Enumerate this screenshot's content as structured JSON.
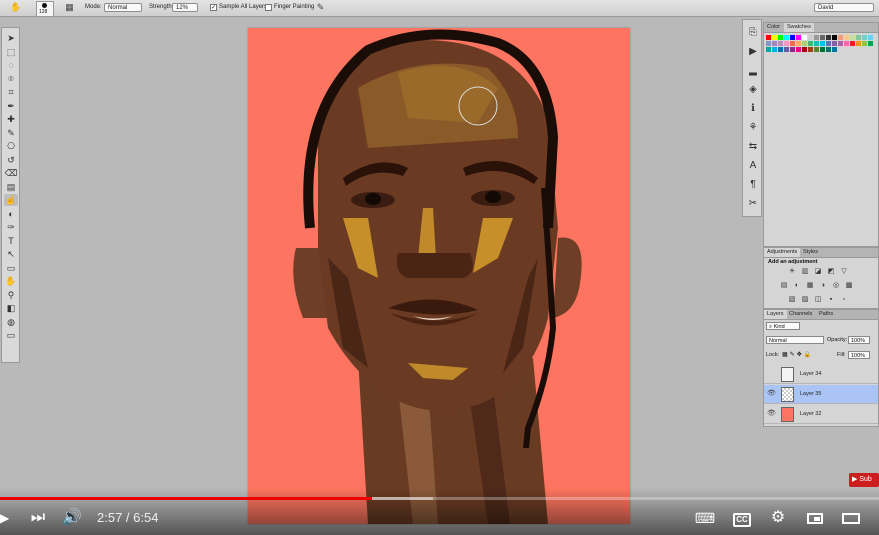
{
  "options_bar": {
    "brush_size": "128",
    "mode_label": "Mode:",
    "mode_value": "Normal",
    "strength_label": "Strength:",
    "strength_value": "12%",
    "sample_all_layers": "Sample All Layers",
    "finger_painting": "Finger Painting",
    "workspace": "David",
    "icons": [
      "smudge-tool-icon",
      "brush-preset-icon",
      "toggle-brush-panel-icon",
      "pressure-icon"
    ]
  },
  "tools": [
    "move-icon",
    "marquee-icon",
    "lasso-icon",
    "quick-select-icon",
    "crop-icon",
    "eyedropper-icon",
    "healing-icon",
    "brush-icon",
    "stamp-icon",
    "history-brush-icon",
    "eraser-icon",
    "gradient-icon",
    "smudge-icon",
    "dodge-icon",
    "pen-icon",
    "type-icon",
    "path-select-icon",
    "shape-icon",
    "hand-icon",
    "zoom-icon",
    "color-swatch-icon",
    "quick-mask-icon",
    "screen-mode-icon"
  ],
  "right_strip_icons": [
    "history-icon",
    "actions-icon",
    "histogram-icon",
    "navigator-icon",
    "info-icon",
    "clone-source-icon",
    "properties-icon",
    "character-icon",
    "paragraph-icon",
    "tool-presets-icon"
  ],
  "swatches_panel": {
    "tabs": [
      "Color",
      "Swatches"
    ],
    "colors": [
      "#ff0000",
      "#ffff00",
      "#00ff00",
      "#00ffff",
      "#0000ff",
      "#ff00ff",
      "#ffffff",
      "#cccccc",
      "#999999",
      "#666666",
      "#333333",
      "#000000",
      "#f7977a",
      "#fdc68a",
      "#c4df9b",
      "#82ca9d",
      "#7bcdc8",
      "#6ecff6",
      "#8493ca",
      "#a187be",
      "#bc8dbf",
      "#f49ac2",
      "#f26c4f",
      "#fbaf5d",
      "#acd372",
      "#3cb878",
      "#1cbbb4",
      "#00bff3",
      "#5674b9",
      "#8560a8",
      "#a864a8",
      "#f06eaa",
      "#ed1c24",
      "#f7941d",
      "#8dc73f",
      "#00a651",
      "#00a99d",
      "#00aeef",
      "#0072bc",
      "#605ca8",
      "#92278f",
      "#ec008c",
      "#9e0b0f",
      "#a0410d",
      "#598527",
      "#007236",
      "#00746b",
      "#0076a3"
    ]
  },
  "adjustments_panel": {
    "tabs": [
      "Adjustments",
      "Styles"
    ],
    "heading": "Add an adjustment"
  },
  "layers_panel": {
    "tabs": [
      "Layers",
      "Channels",
      "Paths"
    ],
    "filter_kind": "Kind",
    "blend_mode": "Normal",
    "opacity_label": "Opacity:",
    "opacity_value": "100%",
    "lock_label": "Lock:",
    "fill_label": "Fill:",
    "fill_value": "100%",
    "layers": [
      {
        "name": "Layer 34",
        "visible": false,
        "selected": false
      },
      {
        "name": "Layer 35",
        "visible": true,
        "selected": true
      },
      {
        "name": "Layer 32",
        "visible": true,
        "selected": false
      }
    ]
  },
  "video": {
    "current_time": "2:57",
    "duration": "6:54",
    "separator": " / ",
    "played_fraction": 0.423,
    "buffered_fraction": 0.493,
    "subscribe": "Sub",
    "icons": [
      "play-icon",
      "next-icon",
      "volume-icon",
      "subtitles-keyboard-icon",
      "cc-icon",
      "settings-icon",
      "miniplayer-icon",
      "theater-icon"
    ],
    "cc_label": "CC"
  }
}
